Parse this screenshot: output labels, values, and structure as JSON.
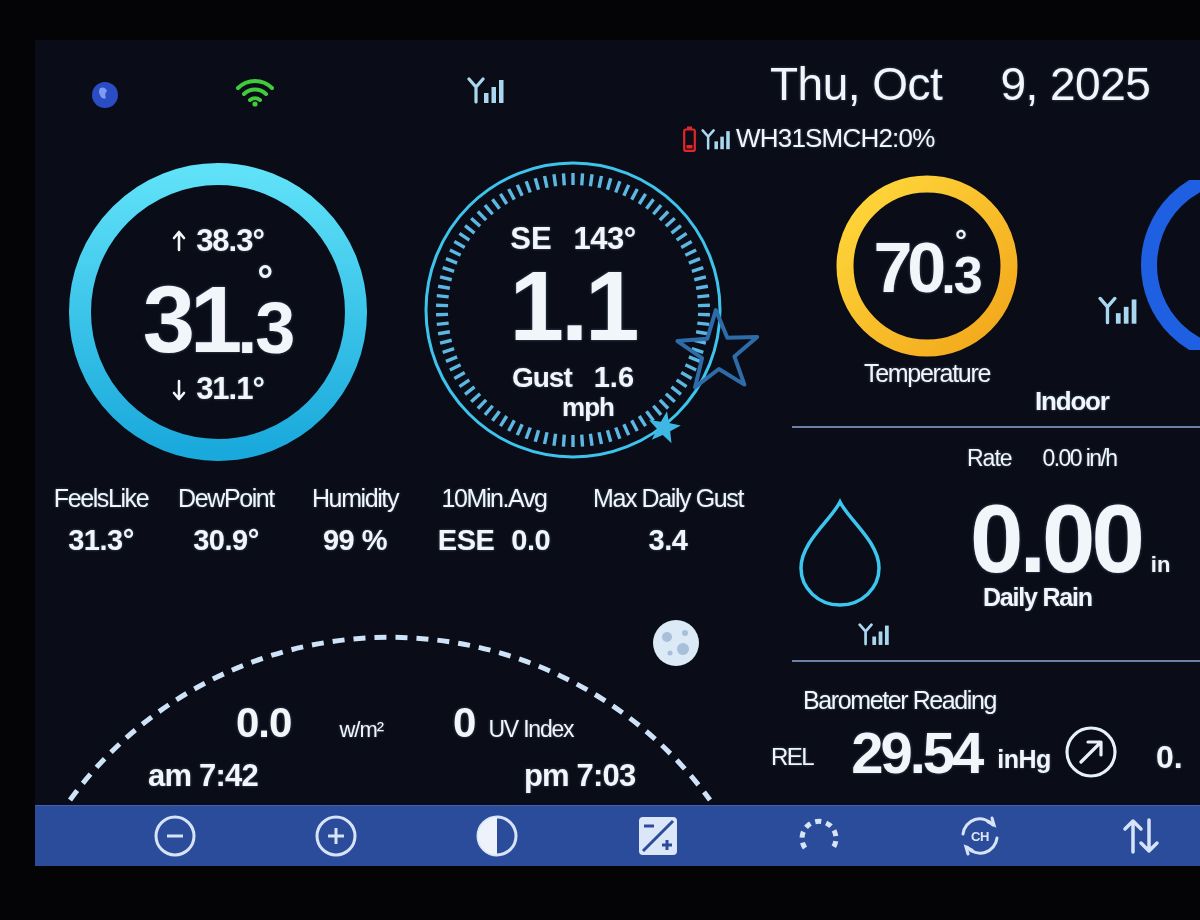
{
  "status_bar": {
    "date": "Thu, Oct",
    "date_year": "9, 2025",
    "sensor": {
      "label": "WH31SMCH2:0%",
      "battery_low": true
    }
  },
  "outdoor_temperature": {
    "high": "38.3°",
    "whole": "31",
    "fraction": ".3",
    "degree": "°",
    "low": "31.1°"
  },
  "wind": {
    "direction": "SE",
    "degrees": "143°",
    "speed": "1.1",
    "gust_label": "Gust",
    "gust": "1.6",
    "unit": "mph"
  },
  "stats": [
    {
      "label": "FeelsLike",
      "value": "31.3°"
    },
    {
      "label": "DewPoint",
      "value": "30.9°"
    },
    {
      "label": "Humidity",
      "value": "99 %"
    },
    {
      "label": "10Min.Avg",
      "direction": "ESE",
      "value": "0.0"
    },
    {
      "label": "Max Daily Gust",
      "value": "3.4"
    }
  ],
  "solar": {
    "radiation": "0.0",
    "radiation_unit": "w/m²",
    "uv": "0",
    "uv_label": "UV Index",
    "sunrise": "am 7:42",
    "sunset": "pm 7:03"
  },
  "indoor": {
    "whole": "70",
    "fraction": ".3",
    "degree": "°",
    "label": "Temperature",
    "title": "Indoor"
  },
  "rain": {
    "rate_label": "Rate",
    "rate": "0.00 in/h",
    "daily": "0.00",
    "unit": "in",
    "label": "Daily Rain"
  },
  "barometer": {
    "title": "Barometer Reading",
    "mode": "REL",
    "value": "29.54",
    "unit": "inHg",
    "change": "0."
  },
  "toolbar": [
    {
      "kind": "minus"
    },
    {
      "kind": "plus"
    },
    {
      "kind": "contrast"
    },
    {
      "kind": "calibrate"
    },
    {
      "kind": "gauge"
    },
    {
      "kind": "channel",
      "label": "CH"
    },
    {
      "kind": "sort"
    }
  ]
}
